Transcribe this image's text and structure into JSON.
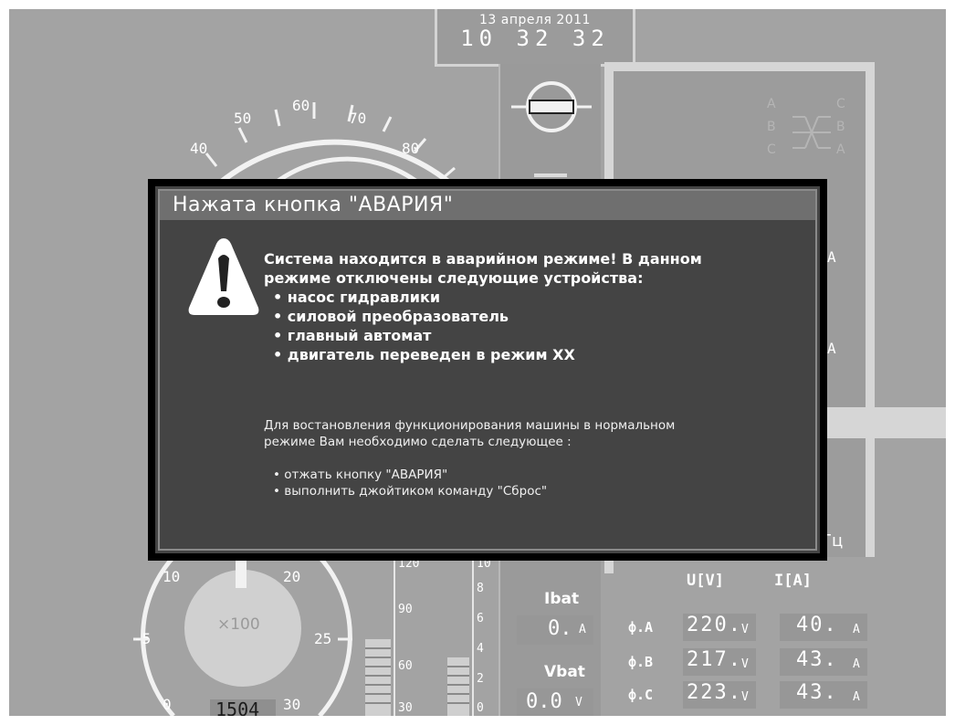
{
  "header": {
    "date": "13 апреля 2011",
    "time": "10 32 32"
  },
  "speed_dial": {
    "ticks": [
      "40",
      "50",
      "60",
      "70",
      "80"
    ]
  },
  "rpm_dial": {
    "ticks": [
      "10",
      "20",
      "-5",
      "25",
      "0",
      "30"
    ],
    "multiplier": "×100",
    "value": "1504"
  },
  "bar_scales": {
    "left": [
      "120",
      "90",
      "60",
      "30"
    ],
    "right": [
      "10",
      "8",
      "6",
      "4",
      "2",
      "0"
    ]
  },
  "battery": {
    "ibat_label": "Ibat",
    "ibat_value": "0.",
    "ibat_unit": "A",
    "vbat_label": "Vbat",
    "vbat_value": "0.0",
    "vbat_unit": "V"
  },
  "phase_diagram": {
    "left": [
      "A",
      "B",
      "C"
    ],
    "right": [
      "C",
      "B",
      "A"
    ]
  },
  "right_units": [
    "A",
    "A",
    "Гц"
  ],
  "measurements": {
    "u_header": "U[V]",
    "i_header": "I[A]",
    "rows": [
      {
        "label": "ф.A",
        "u": "220.",
        "u_unit": "V",
        "i": "40.",
        "i_unit": "A"
      },
      {
        "label": "ф.B",
        "u": "217.",
        "u_unit": "V",
        "i": "43.",
        "i_unit": "A"
      },
      {
        "label": "ф.C",
        "u": "223.",
        "u_unit": "V",
        "i": "43.",
        "i_unit": "A"
      }
    ]
  },
  "dialog": {
    "title": "Нажата кнопка \"АВАРИЯ\"",
    "message_line1": "Система находится в аварийном режиме! В данном",
    "message_line2": "режиме отключены следующие устройства:",
    "devices": [
      "насос гидравлики",
      "силовой преобразователь",
      "главный автомат",
      "двигатель переведен в режим ХХ"
    ],
    "instruction_line1": "Для востановления функционирования машины в нормальном",
    "instruction_line2": "режиме Вам необходимо сделать следующее :",
    "steps": [
      "отжать кнопку \"АВАРИЯ\"",
      "выполнить джойтиком команду \"Сброс\""
    ]
  },
  "colors": {
    "background": "#a3a3a3",
    "dialog_bg": "#444444",
    "dialog_title_bg": "#6f6f6f",
    "dialog_border": "#000000"
  }
}
